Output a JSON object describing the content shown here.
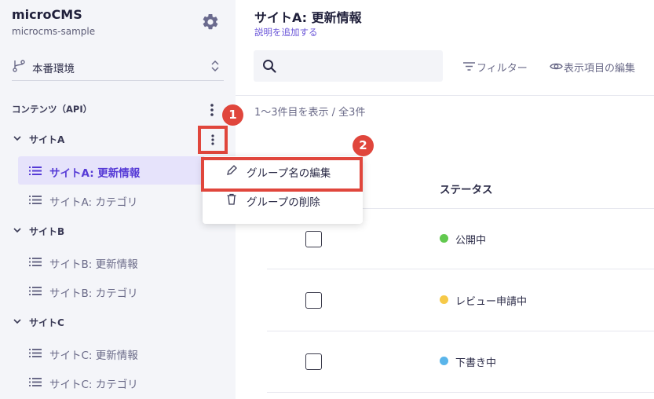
{
  "app": {
    "title": "microCMS",
    "service": "microcms-sample"
  },
  "environment": {
    "label": "本番環境"
  },
  "sidebar": {
    "section_title": "コンテンツ（API）",
    "groups": [
      {
        "label": "サイトA",
        "items": [
          {
            "label": "サイトA: 更新情報"
          },
          {
            "label": "サイトA: カテゴリ"
          }
        ]
      },
      {
        "label": "サイトB",
        "items": [
          {
            "label": "サイトB: 更新情報"
          },
          {
            "label": "サイトB: カテゴリ"
          }
        ]
      },
      {
        "label": "サイトC",
        "items": [
          {
            "label": "サイトC: 更新情報"
          },
          {
            "label": "サイトC: カテゴリ"
          }
        ]
      }
    ]
  },
  "main": {
    "title": "サイトA: 更新情報",
    "description_link": "説明を追加する",
    "search_placeholder": "",
    "filter_label": "フィルター",
    "view_label": "表示項目の編集",
    "count_text": "1〜3件目を表示 / 全3件",
    "status_header": "ステータス",
    "rows": [
      {
        "status": "公開中",
        "status_color": "#62c94f"
      },
      {
        "status": "レビュー申請中",
        "status_color": "#f6c948"
      },
      {
        "status": "下書き中",
        "status_color": "#5ab5ea"
      }
    ]
  },
  "context_menu": {
    "items": [
      {
        "label": "グループ名の編集"
      },
      {
        "label": "グループの削除"
      }
    ]
  },
  "annotations": {
    "badge_1": "1",
    "badge_2": "2"
  },
  "colors": {
    "accent": "#563bd6",
    "annotation": "#e0463c",
    "active_bg": "#e6e3fb",
    "sidebar_bg": "#f4f5f9"
  }
}
